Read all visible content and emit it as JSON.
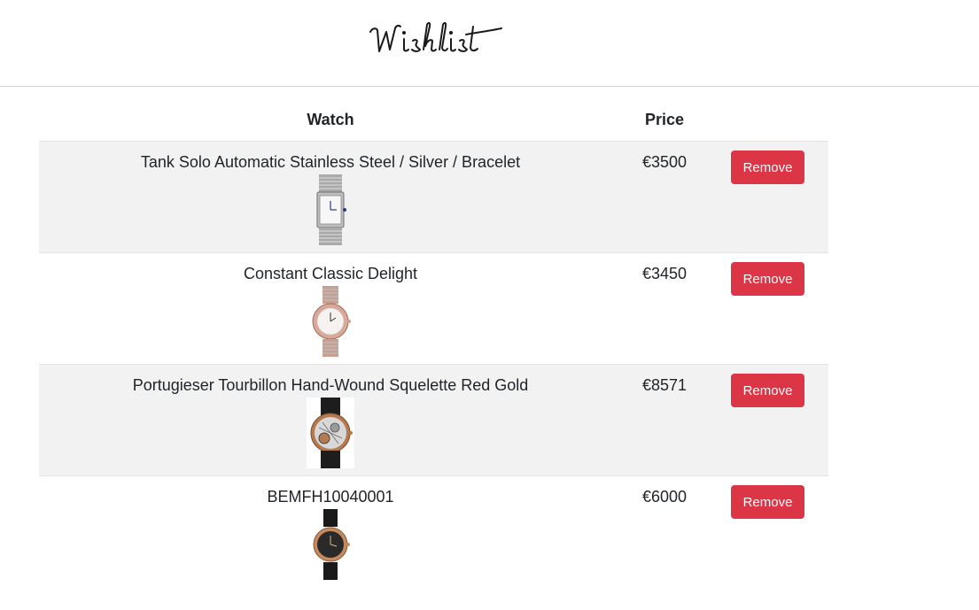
{
  "header": {
    "logo_text": "Wishlist"
  },
  "table": {
    "columns": {
      "watch": "Watch",
      "price": "Price"
    },
    "rows": [
      {
        "name": "Tank Solo Automatic Stainless Steel / Silver / Bracelet",
        "price": "€3500",
        "action": "Remove",
        "image_icon": "silver-rectangular-watch-icon"
      },
      {
        "name": "Constant Classic Delight",
        "price": "€3450",
        "action": "Remove",
        "image_icon": "two-tone-round-watch-icon"
      },
      {
        "name": "Portugieser Tourbillon Hand-Wound Squelette Red Gold",
        "price": "€8571",
        "action": "Remove",
        "image_icon": "skeleton-tourbillon-watch-icon"
      },
      {
        "name": "BEMFH10040001",
        "price": "€6000",
        "action": "Remove",
        "image_icon": "black-dial-gold-watch-icon"
      }
    ]
  },
  "colors": {
    "remove_button": "#dc3545",
    "stripe": "#f2f2f2",
    "header_border": "#c9d3dc"
  }
}
